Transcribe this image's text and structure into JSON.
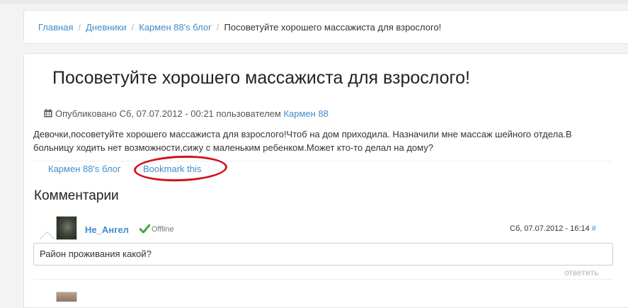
{
  "breadcrumb": {
    "items": [
      "Главная",
      "Дневники",
      "Кармен 88's блог"
    ],
    "separator": "/",
    "current": "Посоветуйте хорошего массажиста для взрослого!"
  },
  "post": {
    "title": "Посоветуйте хорошего массажиста для взрослого!",
    "meta_prefix": "Опубликовано Сб, 07.07.2012 - 00:21 пользователем",
    "author": "Кармен 88",
    "body": "Девочки,посоветуйте хорошего массажиста для взрослого!Чтоб на дом приходила. Назначили мне массаж шейного отдела.В больницу ходить нет возможности,сижу с маленьким ребенком.Может кто-то делал на дому?",
    "links": {
      "blog": "Кармен 88's блог",
      "bookmark": "Bookmark this"
    }
  },
  "comments": {
    "heading": "Комментарии",
    "items": [
      {
        "author": "Не_Ангел",
        "status": "Offline",
        "date": "Сб, 07.07.2012 - 16:14",
        "permalink": "#",
        "text": "Район проживания какой?",
        "reply": "ответить"
      }
    ]
  },
  "colors": {
    "link": "#428bca",
    "highlight_ring": "#d0141a",
    "online_check": "#3cab3a"
  },
  "icons": {
    "calendar": "calendar-icon",
    "status": "check-icon"
  }
}
